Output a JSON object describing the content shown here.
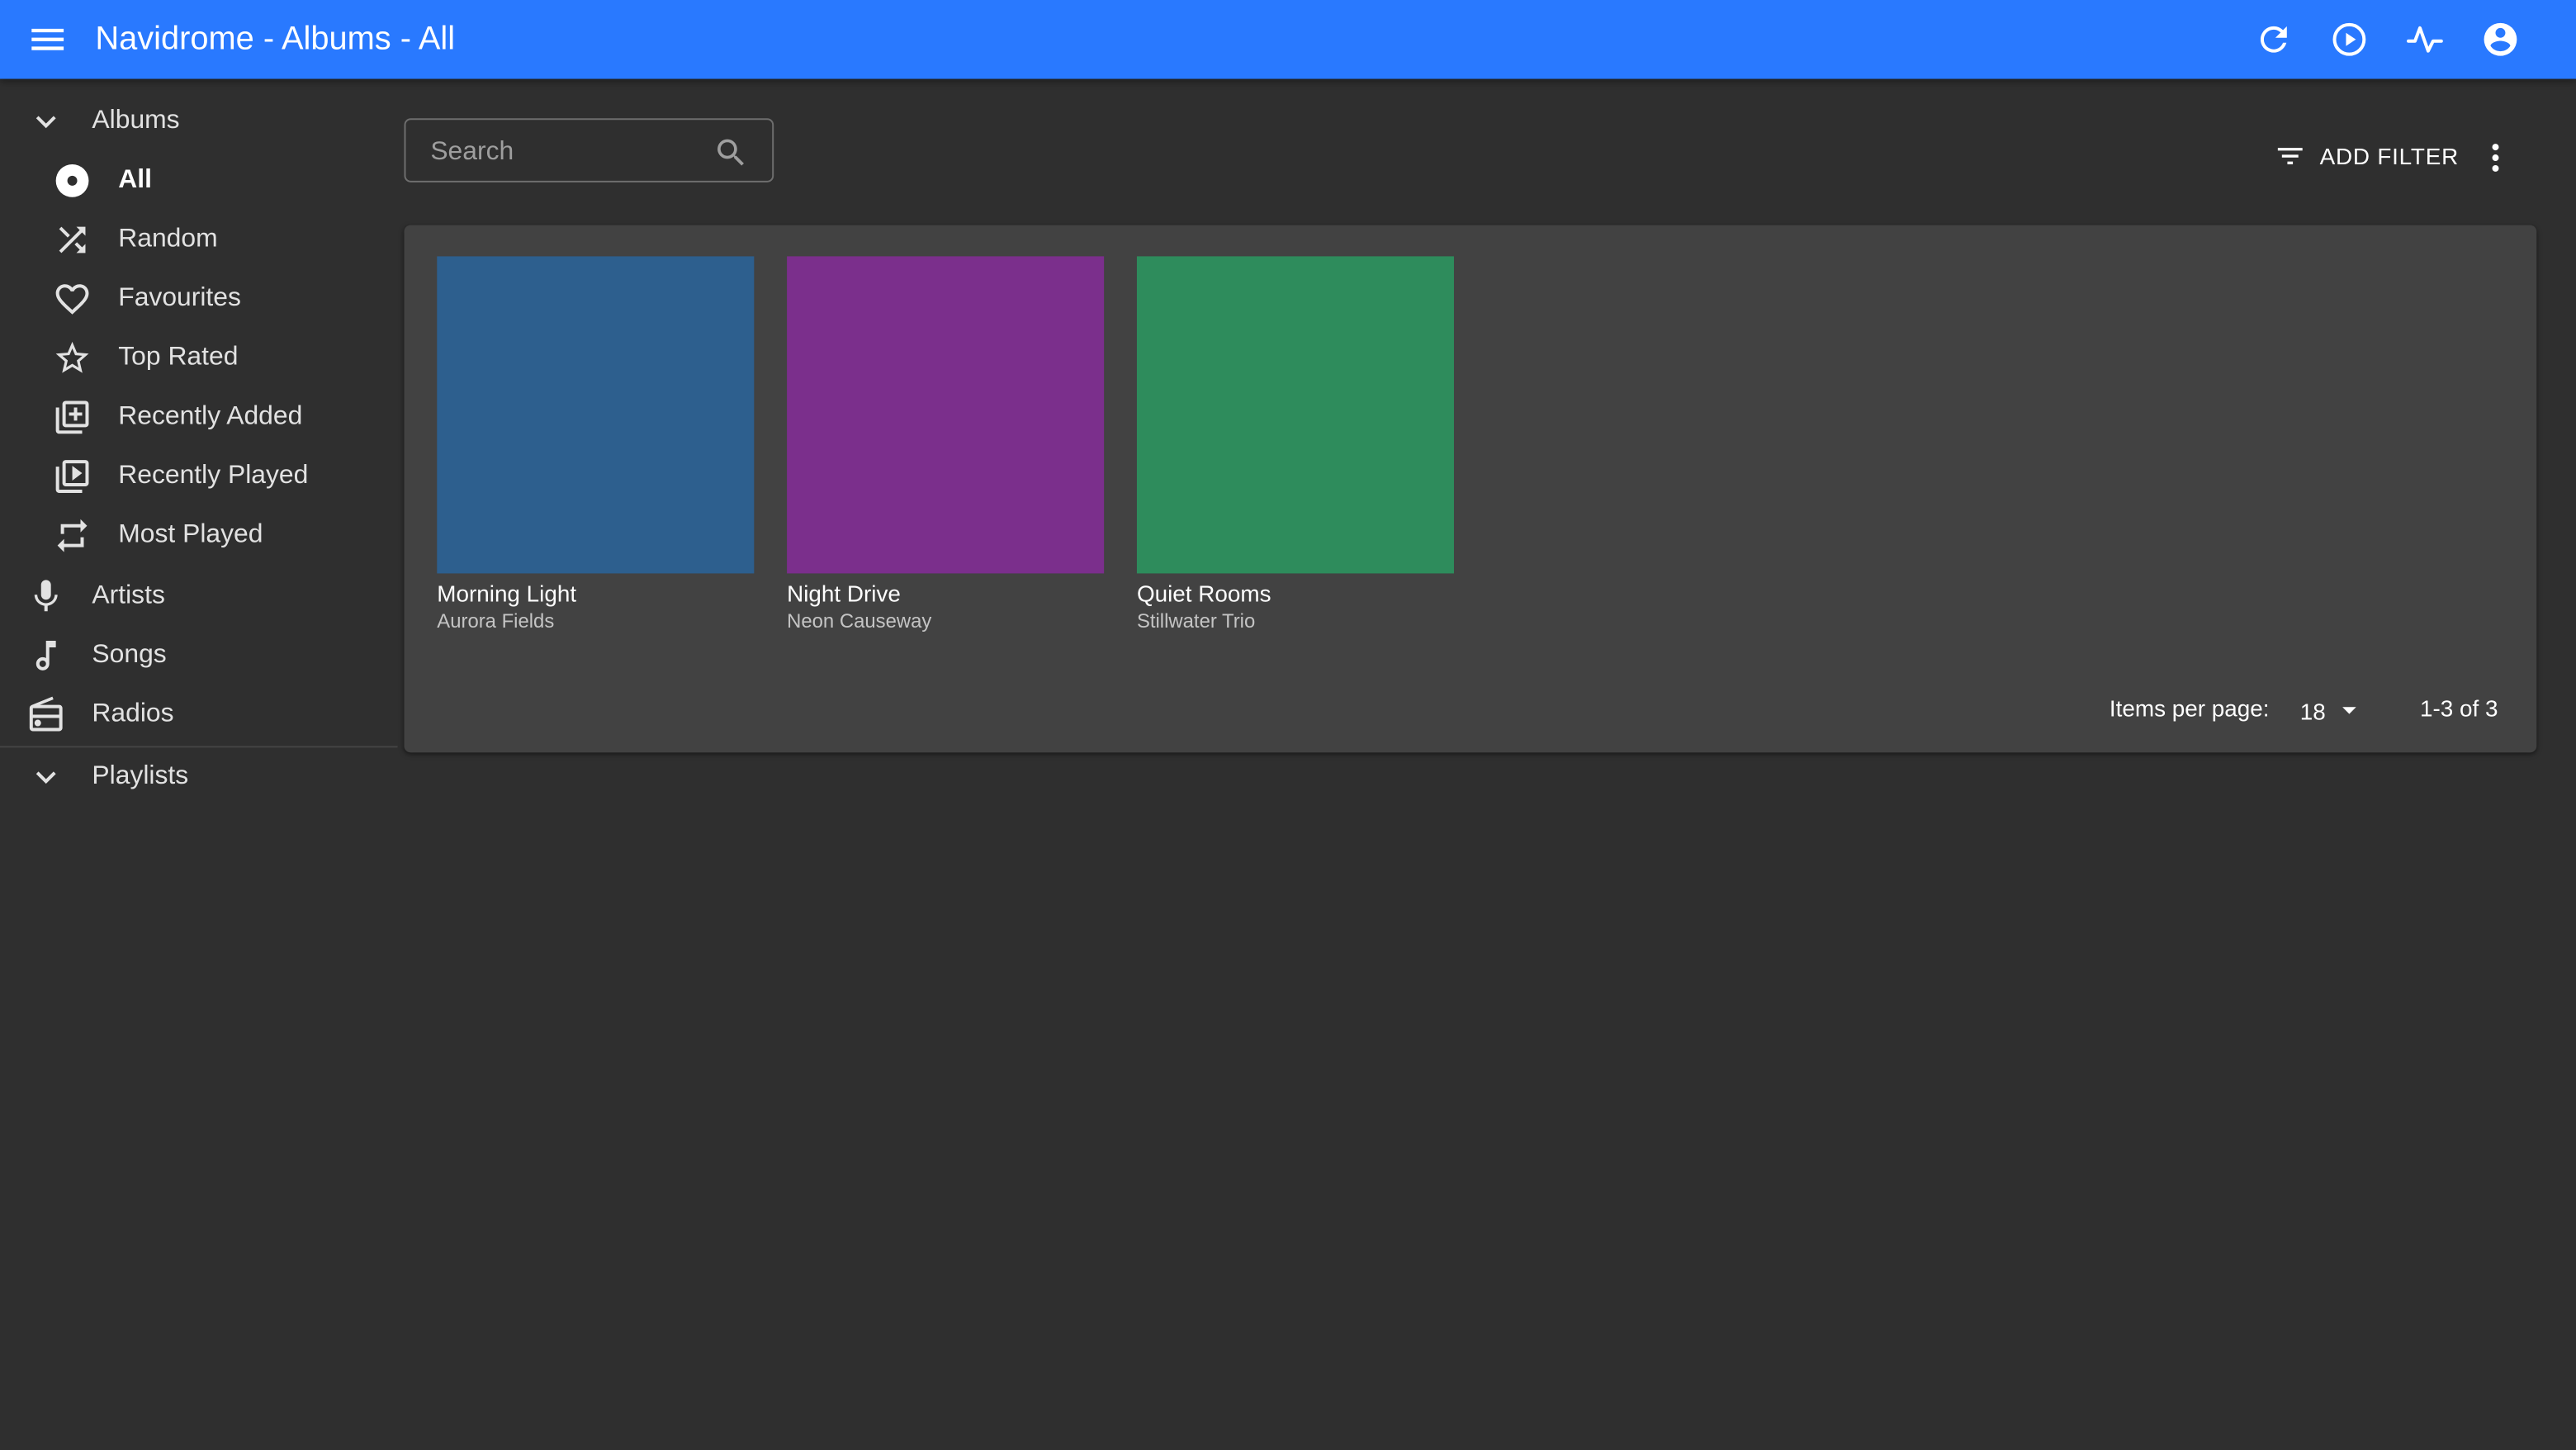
{
  "app": {
    "title": "Navidrome - Albums - All",
    "accent": "#2979ff",
    "background": "#2f2f2f",
    "panel": "#424242"
  },
  "appbar_actions": [
    "refresh-icon",
    "play-circle-icon",
    "activity-icon",
    "account-circle-icon"
  ],
  "sidebar": {
    "groups": [
      {
        "label": "Albums",
        "icon": "chevron-down-icon"
      },
      {
        "label": "Playlists",
        "icon": "chevron-down-icon"
      }
    ],
    "album_items": [
      {
        "label": "All",
        "icon": "album-icon",
        "active": true
      },
      {
        "label": "Random",
        "icon": "shuffle-icon"
      },
      {
        "label": "Favourites",
        "icon": "heart-icon"
      },
      {
        "label": "Top Rated",
        "icon": "star-icon"
      },
      {
        "label": "Recently Added",
        "icon": "library-add-icon"
      },
      {
        "label": "Recently Played",
        "icon": "video-library-icon"
      },
      {
        "label": "Most Played",
        "icon": "repeat-icon"
      }
    ],
    "top_items": [
      {
        "label": "Artists",
        "icon": "microphone-icon"
      },
      {
        "label": "Songs",
        "icon": "music-note-icon"
      },
      {
        "label": "Radios",
        "icon": "radio-icon"
      }
    ]
  },
  "toolbar": {
    "search_placeholder": "Search",
    "add_filter_label": "ADD FILTER"
  },
  "albums": [
    {
      "title": "Morning Light",
      "artist": "Aurora Fields",
      "color": "#2d5f8e"
    },
    {
      "title": "Night Drive",
      "artist": "Neon Causeway",
      "color": "#7b2f8c"
    },
    {
      "title": "Quiet Rooms",
      "artist": "Stillwater Trio",
      "color": "#2e8c5c"
    }
  ],
  "pagination": {
    "items_per_page_label": "Items per page:",
    "items_per_page": "18",
    "range": "1-3 of 3"
  }
}
